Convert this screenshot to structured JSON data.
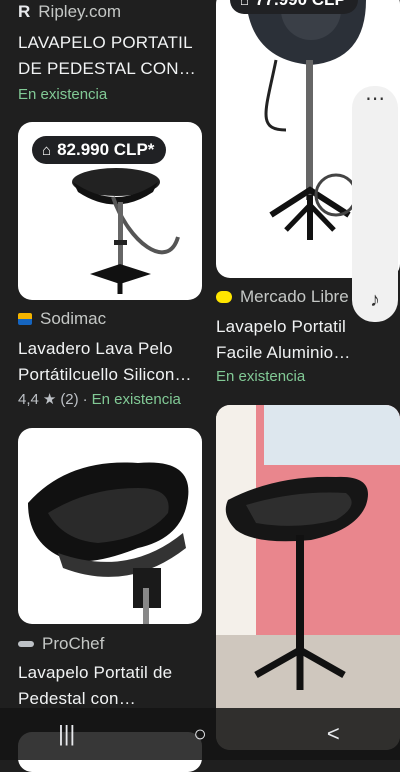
{
  "left": {
    "top": {
      "source": "Ripley.com",
      "title_line1": "LAVAPELO PORTATIL",
      "title_line2": "DE PEDESTAL CON…",
      "stock": "En existencia"
    },
    "card1": {
      "price": "82.990 CLP*",
      "source": "Sodimac",
      "title_line1": "Lavadero Lava Pelo",
      "title_line2": "Portátilcuello Silicon…",
      "rating_value": "4,4",
      "rating_count": "(2)",
      "rating_sep": "·",
      "stock": "En existencia"
    },
    "card2": {
      "source": "ProChef",
      "title_line1": "Lavapelo Portatil de",
      "title_line2": "Pedestal con…"
    }
  },
  "right": {
    "card1": {
      "price_partial": "77.990 CLP",
      "source": "Mercado Libre",
      "title_line1": "Lavapelo Portatil",
      "title_line2": "Facile Aluminio…",
      "stock": "En existencia"
    }
  },
  "icons": {
    "tag": "price-tag-icon",
    "more": "more-vert-icon",
    "sound": "music-note-icon"
  },
  "nav": {
    "recents": "|||",
    "home": "○",
    "back": "<"
  },
  "colors": {
    "background": "#1f1f1f",
    "stock_green": "#81c995",
    "card_white": "#ffffff"
  }
}
